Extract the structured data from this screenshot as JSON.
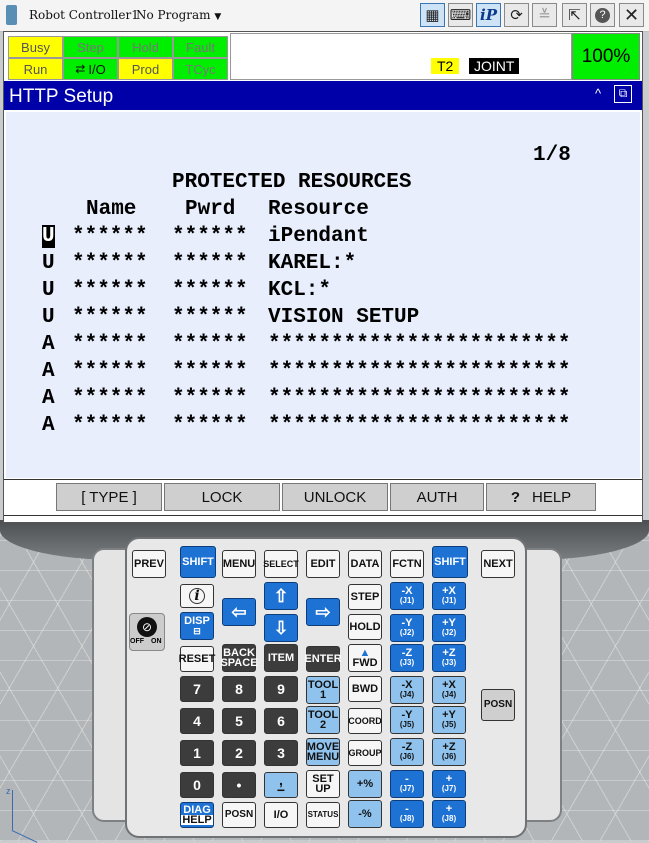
{
  "title_bar": {
    "controller": "Robot Controller1",
    "program": "No Program"
  },
  "status_flags": [
    {
      "label": "Busy",
      "color": "#ffff00"
    },
    {
      "label": "Step",
      "color": "#00ee00"
    },
    {
      "label": "Hold",
      "color": "#00ee00"
    },
    {
      "label": "Fault",
      "color": "#00ee00"
    },
    {
      "label": "Run",
      "color": "#ffff00"
    },
    {
      "label": "I/O",
      "color": "#00ee00"
    },
    {
      "label": "Prod",
      "color": "#ffff00"
    },
    {
      "label": "TCyc",
      "color": "#00ee00"
    }
  ],
  "mode": {
    "t": "T2",
    "coord": "JOINT",
    "override": "100%"
  },
  "screen": {
    "title": "HTTP Setup",
    "page": "1/8",
    "heading": "PROTECTED RESOURCES",
    "col_name": "Name",
    "col_pwrd": "Pwrd",
    "col_resource": "Resource",
    "rows": [
      {
        "flag": "U",
        "name": "******",
        "pwrd": "******",
        "resource": "iPendant"
      },
      {
        "flag": "U",
        "name": "******",
        "pwrd": "******",
        "resource": "KAREL:*"
      },
      {
        "flag": "U",
        "name": "******",
        "pwrd": "******",
        "resource": "KCL:*"
      },
      {
        "flag": "U",
        "name": "******",
        "pwrd": "******",
        "resource": "VISION SETUP"
      },
      {
        "flag": "A",
        "name": "******",
        "pwrd": "******",
        "resource": "************************"
      },
      {
        "flag": "A",
        "name": "******",
        "pwrd": "******",
        "resource": "************************"
      },
      {
        "flag": "A",
        "name": "******",
        "pwrd": "******",
        "resource": "************************"
      },
      {
        "flag": "A",
        "name": "******",
        "pwrd": "******",
        "resource": "************************"
      }
    ]
  },
  "fkeys": [
    "[ TYPE ]",
    "LOCK",
    "UNLOCK",
    "AUTH",
    "HELP"
  ],
  "keypad": {
    "prev": "PREV",
    "shift": "SHIFT",
    "menu": "MENU",
    "select": "SELECT",
    "edit": "EDIT",
    "data": "DATA",
    "fctn": "FCTN",
    "next": "NEXT",
    "info": "i",
    "disp": "DISP",
    "reset": "RESET",
    "back": "BACK",
    "space": "SPACE",
    "item": "ITEM",
    "enter": "ENTER",
    "step": "STEP",
    "hold": "HOLD",
    "fwd": "FWD",
    "bwd": "BWD",
    "coord": "COORD",
    "group": "GROUP",
    "tool": "TOOL",
    "tool1n": "1",
    "tool2n": "2",
    "move": "MOVE",
    "menu2": "MENU",
    "set": "SET",
    "up": "UP",
    "plus_pct": "+%",
    "minus_pct": "-%",
    "diag": "DIAG",
    "help": "HELP",
    "posn": "POSN",
    "io": "I/O",
    "status": "STATUS",
    "off": "OFF",
    "on": "ON",
    "side_posn": "POSN",
    "n7": "7",
    "n8": "8",
    "n9": "9",
    "n4": "4",
    "n5": "5",
    "n6": "6",
    "n1": "1",
    "n2": "2",
    "n3": "3",
    "n0": "0",
    "dot": "•",
    "jog_minus": [
      {
        "axis": "-X",
        "j": "(J1)"
      },
      {
        "axis": "-Y",
        "j": "(J2)"
      },
      {
        "axis": "-Z",
        "j": "(J3)"
      },
      {
        "axis": "-X",
        "j": "(J4)"
      },
      {
        "axis": "-Y",
        "j": "(J5)"
      },
      {
        "axis": "-Z",
        "j": "(J6)"
      },
      {
        "axis": "-",
        "j": "(J7)"
      },
      {
        "axis": "-",
        "j": "(J8)"
      }
    ],
    "jog_plus": [
      {
        "axis": "+X",
        "j": "(J1)"
      },
      {
        "axis": "+Y",
        "j": "(J2)"
      },
      {
        "axis": "+Z",
        "j": "(J3)"
      },
      {
        "axis": "+X",
        "j": "(J4)"
      },
      {
        "axis": "+Y",
        "j": "(J5)"
      },
      {
        "axis": "+Z",
        "j": "(J6)"
      },
      {
        "axis": "+",
        "j": "(J7)"
      },
      {
        "axis": "+",
        "j": "(J8)"
      }
    ]
  }
}
